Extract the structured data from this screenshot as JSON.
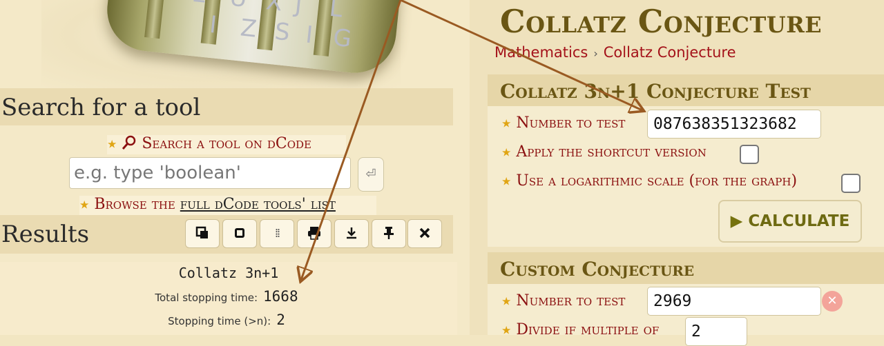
{
  "banner": {
    "cylinder_letters_top": [
      "E",
      "U",
      "X",
      "J",
      "L"
    ],
    "cylinder_letters_bottom": [
      "I",
      "Z",
      "S",
      "I",
      "G"
    ]
  },
  "search": {
    "title": "Search for a tool",
    "tool_link": "Search a tool on dCode",
    "placeholder": "e.g. type 'boolean'",
    "enter_icon": "enter-icon",
    "browse_prefix": "Browse the ",
    "browse_link": "full dCode tools' list"
  },
  "results": {
    "title": "Results",
    "toolbar": [
      "copy-icon",
      "scroll-icon",
      "grip-icon",
      "print-icon",
      "download-icon",
      "pin-icon",
      "close-icon"
    ],
    "output_title": "Collatz 3n+1",
    "rows": [
      {
        "label": "Total stopping time:",
        "value": "1668"
      },
      {
        "label": "Stopping time (>n):",
        "value": "2"
      }
    ]
  },
  "page": {
    "title": "Collatz Conjecture",
    "breadcrumb": [
      "Mathematics",
      "Collatz Conjecture"
    ]
  },
  "test_section": {
    "heading": "Collatz 3n+1 Conjecture Test",
    "number_label": "Number to test",
    "number_value": "087638351323682",
    "shortcut_label": "Apply the shortcut version",
    "shortcut_checked": false,
    "log_label": "Use a logarithmic scale (for the graph)",
    "log_checked": false,
    "calculate_label": "CALCULATE"
  },
  "custom_section": {
    "heading": "Custom Conjecture",
    "number_label": "Number to test",
    "number_value": "2969",
    "divide_label": "Divide if multiple of",
    "divide_value": "2"
  },
  "colors": {
    "link_red": "#8b1010",
    "heading_brown": "#6a5614",
    "arrow": "#9a5a22"
  }
}
